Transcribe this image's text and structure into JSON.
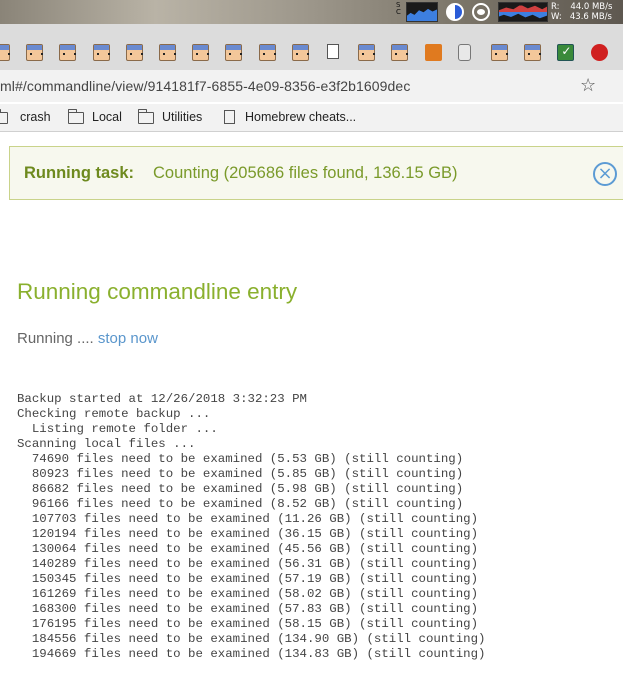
{
  "menubar": {
    "sc_label": "S\nC",
    "net": {
      "read": "R:",
      "read_value": "44.0 MB/s",
      "write": "W:",
      "write_value": "43.6 MB/s"
    }
  },
  "tabs": {
    "favicons": [
      "face-icon",
      "face-icon",
      "face-icon",
      "face-icon",
      "face-icon",
      "face-icon",
      "face-icon",
      "face-icon",
      "face-icon",
      "face-icon",
      "doc-icon",
      "face-icon",
      "face-icon",
      "cube-icon",
      "phone-icon",
      "face-icon",
      "face-icon",
      "check-icon",
      "red-icon"
    ]
  },
  "toolbar": {
    "url": "ml#/commandline/view/914181f7-6855-4e09-8356-e3f2b1609dec"
  },
  "bookmarks": [
    {
      "label": "crash",
      "icon": "folder-icon"
    },
    {
      "label": "Local",
      "icon": "folder-icon"
    },
    {
      "label": "Utilities",
      "icon": "folder-icon"
    },
    {
      "label": "Homebrew cheats...",
      "icon": "page-icon"
    }
  ],
  "task": {
    "label": "Running task:",
    "status": "Counting (205686 files found, 136.15 GB)",
    "close_icon": "×"
  },
  "page": {
    "title": "Running commandline entry",
    "running_text": "Running .... ",
    "stop_link": "stop now"
  },
  "log": [
    "Backup started at 12/26/2018 3:32:23 PM",
    "Checking remote backup ...",
    "  Listing remote folder ...",
    "Scanning local files ...",
    "  74690 files need to be examined (5.53 GB) (still counting)",
    "  80923 files need to be examined (5.85 GB) (still counting)",
    "  86682 files need to be examined (5.98 GB) (still counting)",
    "  96166 files need to be examined (8.52 GB) (still counting)",
    "  107703 files need to be examined (11.26 GB) (still counting)",
    "  120194 files need to be examined (36.15 GB) (still counting)",
    "  130064 files need to be examined (45.56 GB) (still counting)",
    "  140289 files need to be examined (56.31 GB) (still counting)",
    "  150345 files need to be examined (57.19 GB) (still counting)",
    "  161269 files need to be examined (58.02 GB) (still counting)",
    "  168300 files need to be examined (57.83 GB) (still counting)",
    "  176195 files need to be examined (58.15 GB) (still counting)",
    "  184556 files need to be examined (134.90 GB) (still counting)",
    "  194669 files need to be examined (134.83 GB) (still counting)"
  ],
  "colors": {
    "accent_green": "#8ab02e",
    "task_green": "#6e8a1e",
    "link_blue": "#5a96cc"
  }
}
